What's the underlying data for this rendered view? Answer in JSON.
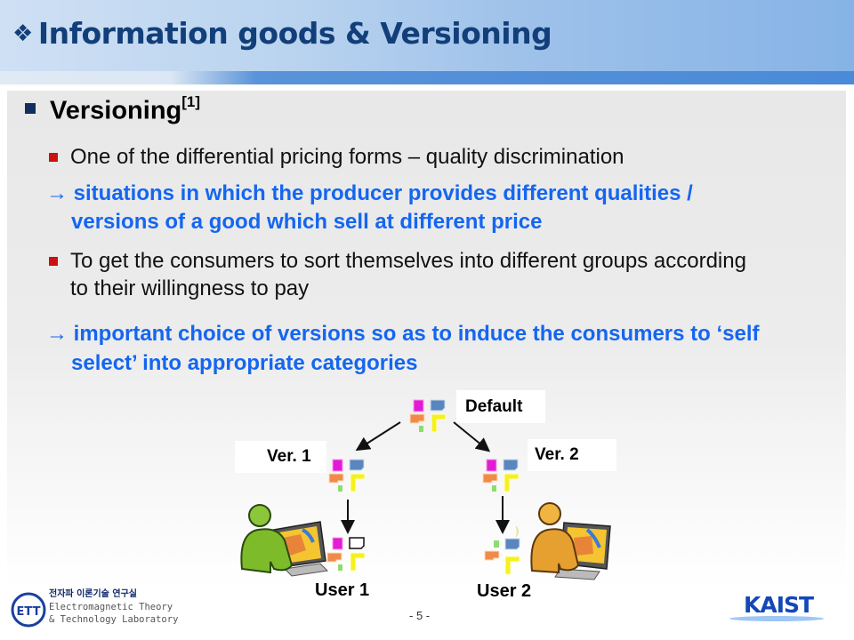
{
  "slide": {
    "title_bullet": "❖",
    "title": "Information goods & Versioning",
    "page_number": "- 5 -"
  },
  "main": {
    "heading": "Versioning",
    "heading_ref": "[1]",
    "bullets": [
      {
        "text": "One of the differential pricing forms – quality discrimination"
      },
      {
        "text_line1": "To get the consumers to sort themselves into different groups according",
        "text_line2": "to their willingness to pay"
      }
    ],
    "arrows": [
      {
        "symbol": "→",
        "line1": " situations in which the producer provides different qualities /",
        "line2": "versions of a good which sell at different price"
      },
      {
        "symbol": "→",
        "line1": " important choice of versions so as to induce the consumers to ‘self",
        "line2": "select’ into appropriate categories"
      }
    ]
  },
  "diagram": {
    "default_label": "Default",
    "ver1_label": "Ver. 1",
    "ver2_label": "Ver. 2",
    "user1_label": "User 1",
    "user2_label": "User 2",
    "piece_colors": {
      "magenta": "#e01cd6",
      "blue": "#5a86be",
      "orange": "#f08a4a",
      "yellow": "#f5f020",
      "green": "#8edc6e"
    },
    "user1_color": "#7dbb2a",
    "user2_color": "#e6a030"
  },
  "footer": {
    "lab_korean": "전자파 이론기술 연구실",
    "lab_line1": "Electromagnetic Theory",
    "lab_line2": "& Technology Laboratory",
    "lab_logo": "ETT",
    "university": "KAIST"
  },
  "colors": {
    "title": "#123f79",
    "accent_blue_text": "#1466f0",
    "bullet_red": "#cc1111"
  }
}
